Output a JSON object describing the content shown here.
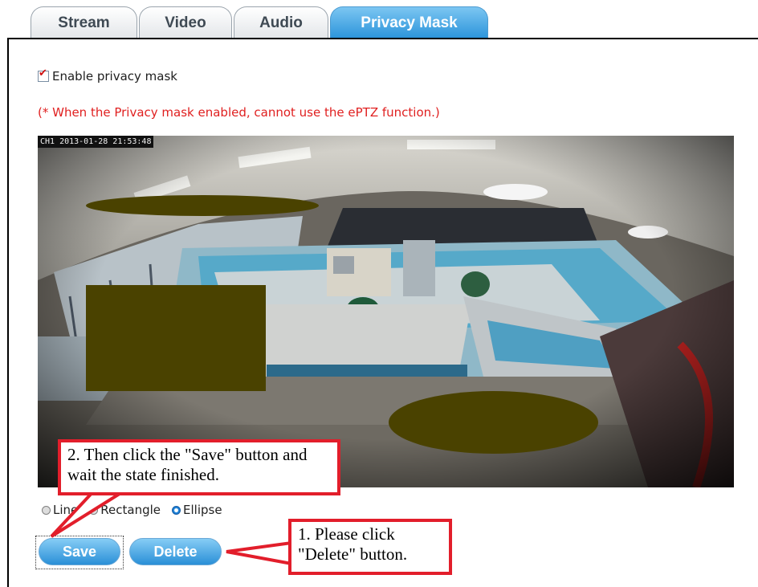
{
  "tabs": [
    {
      "label": "Stream"
    },
    {
      "label": "Video"
    },
    {
      "label": "Audio"
    },
    {
      "label": "Privacy Mask",
      "active": true
    }
  ],
  "enable_checkbox": {
    "label": "Enable privacy mask",
    "checked": true
  },
  "warning": "(* When the Privacy mask enabled, cannot use the ePTZ function.)",
  "camera": {
    "osd": "CH1 2013-01-28 21:53:48"
  },
  "shape_options": {
    "items": [
      {
        "label": "Line",
        "selected": false
      },
      {
        "label": "Rectangle",
        "selected": false
      },
      {
        "label": "Ellipse",
        "selected": true
      }
    ]
  },
  "buttons": {
    "save": "Save",
    "delete": "Delete"
  },
  "callouts": {
    "step1": "1. Please click \"Delete\" button.",
    "step2": "2. Then click the \"Save\" button and wait the state finished."
  },
  "colors": {
    "mask": "#4a4200",
    "accent": "#2a8fd7",
    "callout_border": "#e21e2b",
    "warning": "#e02020"
  }
}
